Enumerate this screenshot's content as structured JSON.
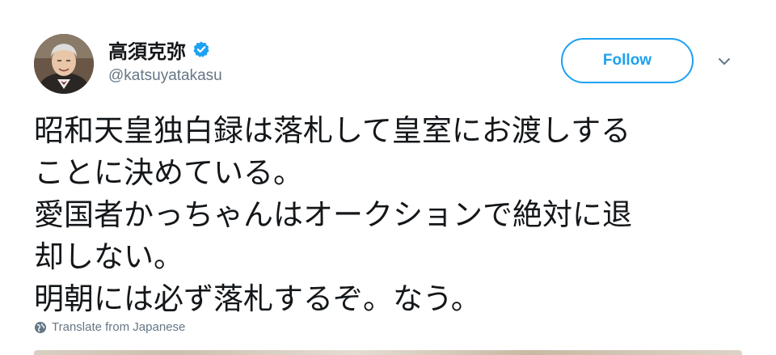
{
  "author": {
    "display_name": "高須克弥",
    "handle": "@katsuyatakasu",
    "verified": true
  },
  "actions": {
    "follow_label": "Follow"
  },
  "icons": {
    "verified": "verified-badge-icon",
    "caret": "chevron-down-icon",
    "translate": "globe-icon"
  },
  "tweet": {
    "lines": [
      "昭和天皇独白録は落札して皇室にお渡しする",
      "ことに決めている。",
      "愛国者かっちゃんはオークションで絶対に退",
      "却しない。",
      "明朝には必ず落札するぞ。なう。"
    ]
  },
  "translate": {
    "label": "Translate from Japanese"
  },
  "colors": {
    "accent": "#1da1f2",
    "text_primary": "#14171a",
    "text_secondary": "#657786"
  }
}
